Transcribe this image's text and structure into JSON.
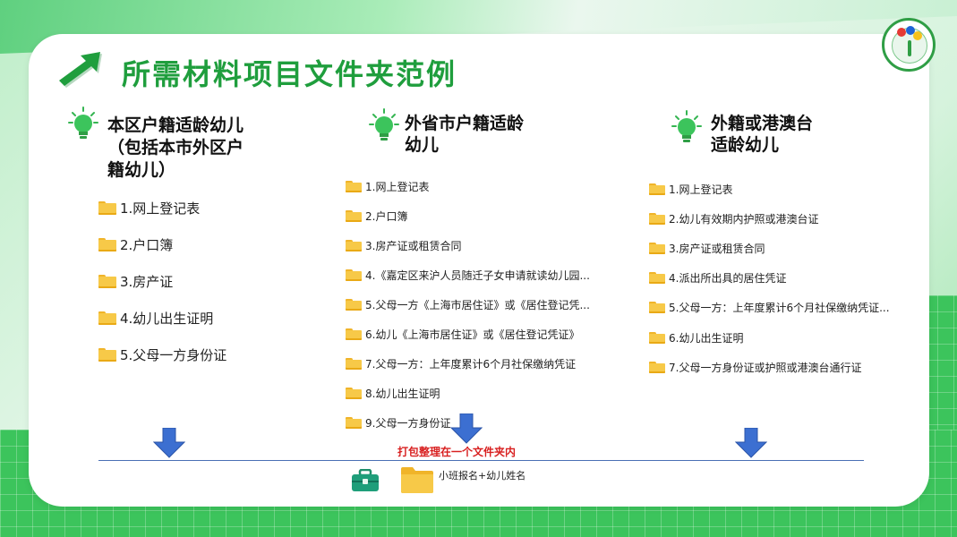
{
  "title": "所需材料项目文件夹范例",
  "columns": [
    {
      "heading_lines": [
        "本区户籍适龄幼儿",
        "（包括本市外区户",
        "籍幼儿）"
      ],
      "items": [
        "1.网上登记表",
        "2.户口簿",
        "3.房产证",
        "4.幼儿出生证明",
        "5.父母一方身份证"
      ]
    },
    {
      "heading_lines": [
        "外省市户籍适龄",
        "幼儿"
      ],
      "items": [
        "1.网上登记表",
        "2.户口簿",
        "3.房产证或租赁合同",
        "4.《嘉定区来沪人员随迁子女申请就读幼儿园...",
        "5.父母一方《上海市居住证》或《居住登记凭...",
        "6.幼儿《上海市居住证》或《居住登记凭证》",
        "7.父母一方：上年度累计6个月社保缴纳凭证",
        "8.幼儿出生证明",
        "9.父母一方身份证"
      ]
    },
    {
      "heading_lines": [
        "外籍或港澳台",
        "适龄幼儿"
      ],
      "items": [
        "1.网上登记表",
        "2.幼儿有效期内护照或港澳台证",
        "3.房产证或租赁合同",
        "4.派出所出具的居住凭证",
        "5.父母一方：上年度累计6个月社保缴纳凭证...",
        "6.幼儿出生证明",
        "7.父母一方身份证或护照或港澳台通行证"
      ]
    }
  ],
  "pack_label": "打包整理在一个文件夹内",
  "folder_label": "小班报名+幼儿姓名",
  "icons": [
    "arrow-icon",
    "bulb-icon",
    "folder-icon",
    "down-arrow-icon",
    "toolbox-icon"
  ],
  "colors": {
    "accent": "#1f9e3d",
    "arrow_blue": "#3c6fd1",
    "pack_red": "#d81f1f"
  }
}
